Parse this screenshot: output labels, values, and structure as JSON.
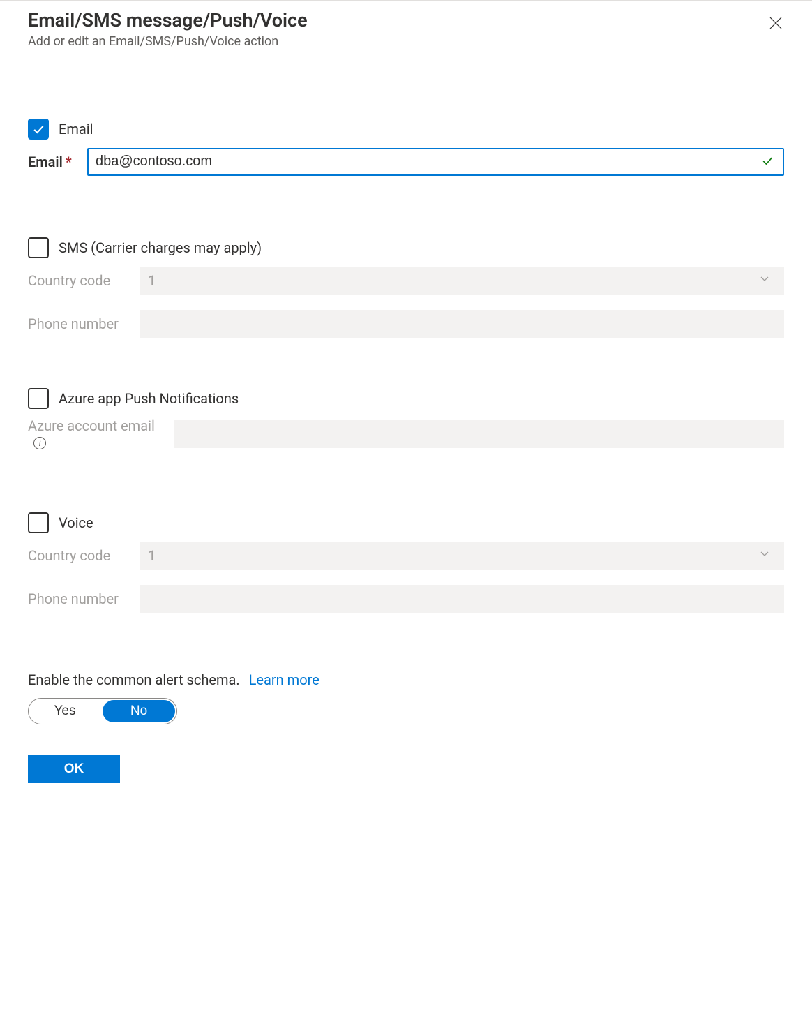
{
  "header": {
    "title": "Email/SMS message/Push/Voice",
    "subtitle": "Add or edit an Email/SMS/Push/Voice action"
  },
  "email": {
    "checkbox_label": "Email",
    "field_label": "Email",
    "required_mark": "*",
    "value": "dba@contoso.com"
  },
  "sms": {
    "checkbox_label": "SMS (Carrier charges may apply)",
    "country_code_label": "Country code",
    "country_code_value": "1",
    "phone_label": "Phone number"
  },
  "push": {
    "checkbox_label": "Azure app Push Notifications",
    "account_label": "Azure account email"
  },
  "voice": {
    "checkbox_label": "Voice",
    "country_code_label": "Country code",
    "country_code_value": "1",
    "phone_label": "Phone number"
  },
  "schema": {
    "text": "Enable the common alert schema.",
    "learn_more": "Learn more",
    "yes": "Yes",
    "no": "No"
  },
  "buttons": {
    "ok": "OK"
  }
}
